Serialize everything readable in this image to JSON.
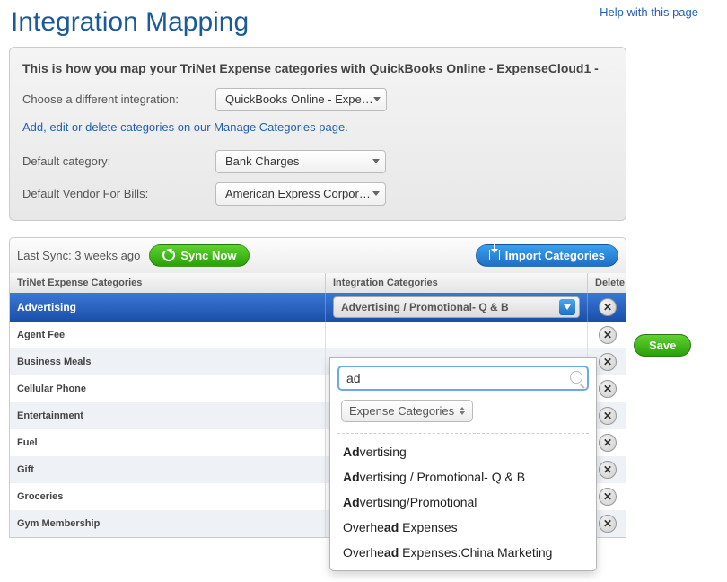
{
  "header": {
    "title": "Integration Mapping",
    "help_link": "Help with this page"
  },
  "config": {
    "description": "This is how you map your TriNet Expense categories with QuickBooks Online - ExpenseCloud1 -",
    "choose_label": "Choose a different integration:",
    "choose_value": "QuickBooks Online - Expe…",
    "manage_link": "Add, edit or delete categories on our Manage Categories page.",
    "default_category_label": "Default category:",
    "default_category_value": "Bank Charges",
    "default_vendor_label": "Default Vendor For Bills:",
    "default_vendor_value": "American Express Corpor…"
  },
  "toolbar": {
    "last_sync": "Last Sync: 3 weeks ago",
    "sync_label": "Sync Now",
    "import_label": "Import Categories"
  },
  "table": {
    "col_expense": "TriNet Expense Categories",
    "col_integration": "Integration Categories",
    "col_delete": "Delete",
    "active_row": {
      "name": "Advertising",
      "integration_value": "Advertising / Promotional- Q & B"
    },
    "rows": [
      {
        "name": "Agent Fee"
      },
      {
        "name": "Business Meals"
      },
      {
        "name": "Cellular Phone"
      },
      {
        "name": "Entertainment"
      },
      {
        "name": "Fuel"
      },
      {
        "name": "Gift"
      },
      {
        "name": "Groceries"
      },
      {
        "name": "Gym Membership"
      }
    ],
    "del_glyph": "✕"
  },
  "dropdown": {
    "search_value": "ad",
    "filter_label": "Expense Categories",
    "options_pre": [
      "Ad",
      "Ad",
      "Ad",
      "Overhe",
      "Overhe"
    ],
    "options_post": [
      "vertising",
      "vertising / Promotional- Q & B",
      "vertising/Promotional",
      " Expenses",
      " Expenses:China Marketing"
    ],
    "options_mid": [
      "",
      "",
      "",
      "ad",
      "ad"
    ]
  },
  "buttons": {
    "save": "Save"
  }
}
